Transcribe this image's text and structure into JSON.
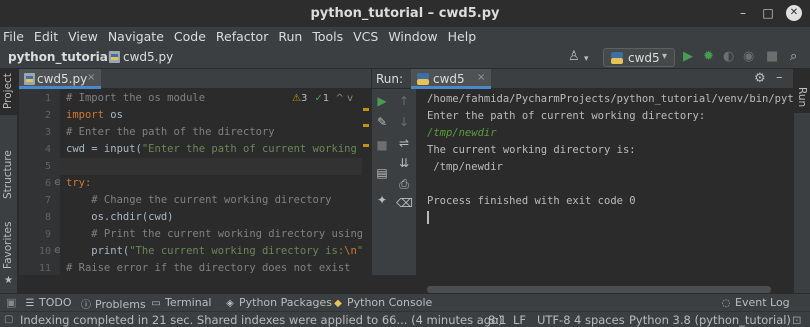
{
  "window": {
    "title": "python_tutorial – cwd5.py",
    "minimize_glyph": "–",
    "maximize_glyph": "□",
    "close_glyph": "✕"
  },
  "menu": [
    "File",
    "Edit",
    "View",
    "Navigate",
    "Code",
    "Refactor",
    "Run",
    "Tools",
    "VCS",
    "Window",
    "Help"
  ],
  "navbar": {
    "project": "python_tutorial",
    "separator": "›",
    "file": "cwd5.py",
    "run_config": "cwd5",
    "run_config_arrow": "▾"
  },
  "left_stripe": {
    "project": "Project",
    "structure": "Structure",
    "favorites": "Favorites"
  },
  "right_stripe": {
    "run": "Run"
  },
  "editor": {
    "tab_label": "cwd5.py",
    "tab_close": "×",
    "inspection_warnings": "3",
    "inspection_weak": "1",
    "line_numbers": [
      "1",
      "2",
      "3",
      "4",
      "5",
      "6",
      "7",
      "8",
      "9",
      "10",
      "11"
    ],
    "lines": {
      "l1": "# Import the os module",
      "l2_kw": "import",
      "l2_rest": " os",
      "l3": "# Enter the path of the directory",
      "l4_a": "cwd = input(",
      "l4_str": "\"Enter the path of current working d",
      "l6_kw": "try",
      "l6_rest": ":",
      "l7": "    # Change the current working directory",
      "l8": "    os.chdir(cwd)",
      "l9": "    # Print the current working directory using",
      "l10_a": "    print(",
      "l10_str": "\"The current working directory is:",
      "l10_esc": "\\n",
      "l10_end": "\",",
      "l11": "# Raise error if the directory does not exist"
    }
  },
  "run_panel": {
    "label": "Run:",
    "tab_label": "cwd5",
    "tab_close": "×",
    "console": {
      "line1": "/home/fahmida/PycharmProjects/python_tutorial/venv/bin/pyt",
      "line2": "Enter the path of current working directory:",
      "line3_input": "/tmp/newdir",
      "line4": "The current working directory is:",
      "line5": " /tmp/newdir",
      "line7": "Process finished with exit code 0"
    }
  },
  "bottom_tools": {
    "todo": "TODO",
    "problems": "Problems",
    "terminal": "Terminal",
    "python_packages": "Python Packages",
    "python_console": "Python Console",
    "event_log": "Event Log"
  },
  "status": {
    "message": "Indexing completed in 21 sec. Shared indexes were applied to 66... (4 minutes ago)",
    "position": "8:1",
    "line_separator": "LF",
    "encoding": "UTF-8",
    "indent": "4 spaces",
    "interpreter": "Python 3.8 (python_tutorial)"
  },
  "icons": {
    "run": "run-icon",
    "debug": "debug-icon",
    "stop": "stop-icon",
    "search": "search-icon",
    "colors": {
      "accent": "#4a88c7",
      "run_green": "#499c54",
      "warning": "#be9117"
    }
  }
}
